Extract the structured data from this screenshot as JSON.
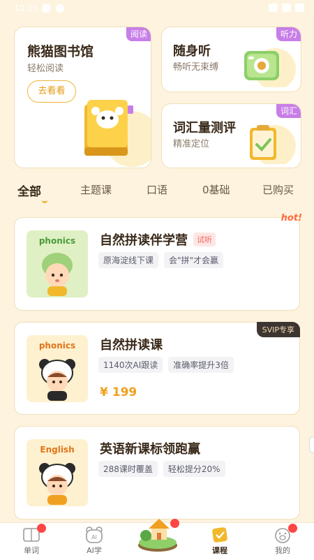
{
  "status": {
    "time": "10:26"
  },
  "features": {
    "library": {
      "title": "熊猫图书馆",
      "subtitle": "轻松阅读",
      "button": "去看看",
      "tag": "阅读"
    },
    "listen": {
      "title": "随身听",
      "subtitle": "畅听无束缚",
      "tag": "听力"
    },
    "vocab": {
      "title": "词汇量测评",
      "subtitle": "精准定位",
      "tag": "词汇"
    }
  },
  "tabs": [
    "全部",
    "主题课",
    "口语",
    "0基础",
    "已购买"
  ],
  "courses": [
    {
      "thumb_word": "phonics",
      "title": "自然拼读伴学营",
      "badge": "试听",
      "corner": "hot!",
      "tags": [
        "原海淀线下课",
        "会\"拼\"才会赢"
      ],
      "price": ""
    },
    {
      "thumb_word": "phonics",
      "title": "自然拼读课",
      "badge": "",
      "corner": "SVIP专享",
      "tags": [
        "1140次AI跟读",
        "准确率提升3倍"
      ],
      "price": "¥ 199"
    },
    {
      "thumb_word": "English",
      "title": "英语新课标领跑赢",
      "badge": "",
      "corner": "",
      "tags": [
        "288课时覆盖",
        "轻松提分20%"
      ],
      "price": ""
    }
  ],
  "tabbar": [
    {
      "label": "单词",
      "icon": "book-icon"
    },
    {
      "label": "AI学",
      "icon": "ai-bear-icon"
    },
    {
      "label": "",
      "icon": "house-island-icon"
    },
    {
      "label": "课程",
      "icon": "course-icon"
    },
    {
      "label": "我的",
      "icon": "pig-face-icon"
    }
  ],
  "colors": {
    "accent": "#f0b53a",
    "bg": "#fdf3df",
    "badge_red": "#ff4444",
    "tag_purple": "#c77ee8"
  }
}
